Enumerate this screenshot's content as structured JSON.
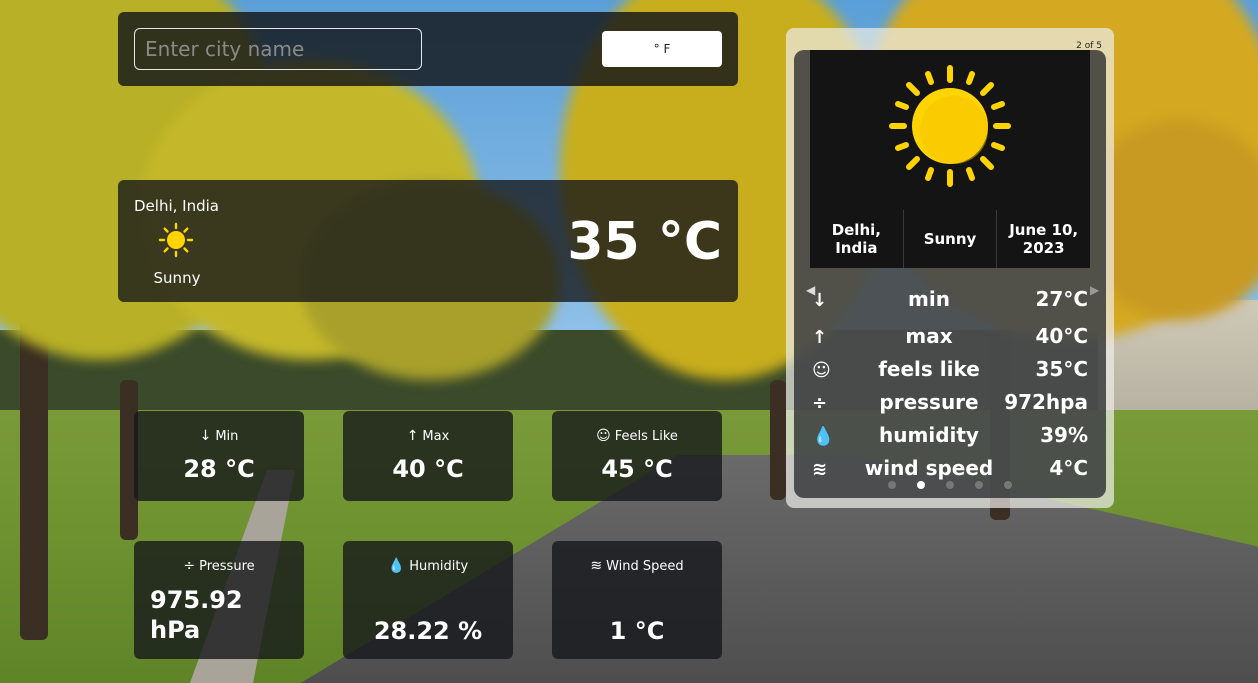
{
  "search": {
    "placeholder": "Enter city name",
    "unit_toggle_label": "° F"
  },
  "current": {
    "city": "Delhi, India",
    "condition": "Sunny",
    "temperature": "35 °C",
    "icon": "sun-icon"
  },
  "tiles": [
    {
      "icon": "arrow-down-icon",
      "label": "Min",
      "value": "28 °C"
    },
    {
      "icon": "arrow-up-icon",
      "label": "Max",
      "value": "40 °C"
    },
    {
      "icon": "smile-icon",
      "label": "Feels Like",
      "value": "45 °C"
    },
    {
      "icon": "pressure-icon",
      "label": "Pressure",
      "value_line1": "975.92",
      "value_line2": "hPa"
    },
    {
      "icon": "droplet-icon",
      "label": "Humidity",
      "value": "28.22 %"
    },
    {
      "icon": "wind-icon",
      "label": "Wind Speed",
      "value": "1 °C"
    }
  ],
  "carousel": {
    "counter": "2 of 5",
    "city": "Delhi, India",
    "condition": "Sunny",
    "date": "June 10, 2023",
    "icon": "sun-icon",
    "details": [
      {
        "icon": "arrow-down-icon",
        "label": "min",
        "value": "27°C"
      },
      {
        "icon": "arrow-up-icon",
        "label": "max",
        "value": "40°C"
      },
      {
        "icon": "smile-icon",
        "label": "feels like",
        "value": "35°C"
      },
      {
        "icon": "pressure-icon",
        "label": "pressure",
        "value": "972hpa"
      },
      {
        "icon": "droplet-icon",
        "label": "humidity",
        "value": "39%"
      },
      {
        "icon": "wind-icon",
        "label": "wind speed",
        "value": "4°C"
      }
    ],
    "slide_count": 5,
    "active_slide": 2
  },
  "colors": {
    "sun": "#FFD400",
    "panel": "#14161a"
  }
}
